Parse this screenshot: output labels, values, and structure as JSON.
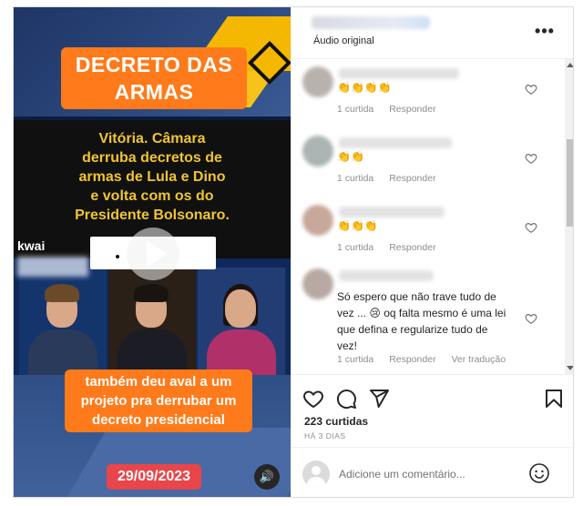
{
  "video": {
    "title_lines": [
      "DECRETO DAS",
      "ARMAS"
    ],
    "headline_lines": [
      "Vitória. Câmara",
      "derruba decretos de",
      "armas de Lula e Dino",
      "e volta com os do",
      "Presidente Bolsonaro."
    ],
    "watermark": "kwai",
    "caption_lines": [
      "também deu aval a um",
      "projeto pra derrubar um",
      "decreto presidencial"
    ],
    "date": "29/09/2023",
    "play_icon": "play-icon",
    "sound_icon": "speaker-icon"
  },
  "post": {
    "audio_label": "Áudio original",
    "more_icon": "more-options-icon"
  },
  "comments": [
    {
      "text_lines": [
        "👏👏👏👏"
      ],
      "likes": "1 curtida",
      "reply": "Responder",
      "translate": ""
    },
    {
      "text_lines": [
        "👏👏"
      ],
      "likes": "1 curtida",
      "reply": "Responder",
      "translate": ""
    },
    {
      "text_lines": [
        "👏👏👏"
      ],
      "likes": "1 curtida",
      "reply": "Responder",
      "translate": ""
    },
    {
      "text_lines": [
        "Só espero que não trave tudo de",
        "vez ... 😢 oq falta mesmo é uma lei",
        "que defina e regularize tudo de",
        "vez!"
      ],
      "likes": "1 curtida",
      "reply": "Responder",
      "translate": "Ver tradução"
    }
  ],
  "actions": {
    "likes_count": "223 curtidas",
    "time_ago": "HÁ 3 DIAS",
    "icons": [
      "heart-icon",
      "comment-icon",
      "share-icon",
      "bookmark-icon"
    ]
  },
  "add_comment": {
    "placeholder": "Adicione um comentário...",
    "emoji_icon": "emoji-icon"
  },
  "colors": {
    "orange": "#ff7a1a",
    "headline_yellow": "#f0c531",
    "date_red": "#e8464a",
    "meta_gray": "#8e8e8e"
  }
}
